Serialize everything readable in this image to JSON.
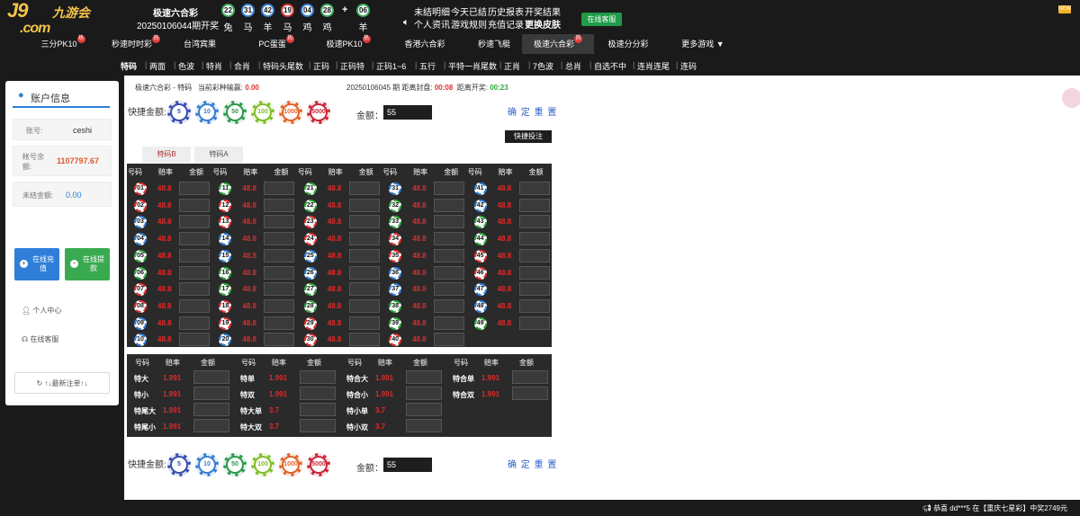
{
  "header": {
    "logo": "J9",
    "logo_sub": ".com",
    "logo_cn": "九游会",
    "draw_name": "极速六合彩",
    "draw_issue": "20250106044期开奖",
    "result_balls": [
      {
        "num": "22",
        "zodiac": "兔",
        "color": "g"
      },
      {
        "num": "31",
        "zodiac": "马",
        "color": "b"
      },
      {
        "num": "42",
        "zodiac": "羊",
        "color": "b"
      },
      {
        "num": "19",
        "zodiac": "马",
        "color": "r"
      },
      {
        "num": "04",
        "zodiac": "鸡",
        "color": "b"
      },
      {
        "num": "28",
        "zodiac": "鸡",
        "color": "g"
      },
      {
        "num": "06",
        "zodiac": "羊",
        "color": "g"
      }
    ],
    "plus": "+",
    "links_row1": [
      "未结明细",
      "今天已结",
      "历史报表",
      "开奖结果"
    ],
    "links_row2": [
      "个人资讯",
      "游戏规则",
      "充值记录",
      "更换皮肤"
    ],
    "cs_button": "在线客服",
    "new_tag": "NEW"
  },
  "game_nav": [
    {
      "label": "三分PK10",
      "hot": true
    },
    {
      "label": "秒速时时彩",
      "hot": true
    },
    {
      "label": "台湾宾果",
      "hot": false
    },
    {
      "label": "PC蛋蛋",
      "hot": true
    },
    {
      "label": "极速PK10",
      "hot": true
    },
    {
      "label": "香港六合彩",
      "hot": false
    },
    {
      "label": "秒速飞艇",
      "hot": false
    },
    {
      "label": "极速六合彩",
      "hot": true
    },
    {
      "label": "极速分分彩",
      "hot": false
    },
    {
      "label": "更多游戏 ▼",
      "hot": false
    }
  ],
  "hot_label": "热",
  "sub_nav": [
    "特码",
    "两面",
    "色波",
    "特肖",
    "合肖",
    "特码头尾数",
    "正码",
    "正码特",
    "正码1~6",
    "五行",
    "平特一肖尾数",
    "正肖",
    "7色波",
    "总肖",
    "自选不中",
    "连肖连尾",
    "连码"
  ],
  "sidebar": {
    "title": "账户信息",
    "account_label": "账号:",
    "account_value": "ceshi",
    "balance_label": "帐号余额:",
    "balance_value": "1107797.67",
    "unsettled_label": "未结金额:",
    "unsettled_value": "0.00",
    "deposit_label": "在线充值",
    "withdraw_label": "在线提款",
    "personal_center": "个人中心",
    "online_service": "在线客服",
    "refresh": "↑↓最新注单↑↓"
  },
  "content": {
    "crumb_game": "极速六合彩",
    "crumb_dash": "-",
    "crumb_play": "特码",
    "crumb_win_label": "当前彩种输赢:",
    "crumb_win_value": "0.00",
    "crumb_issue": "20250106045 期 距离封盘:",
    "crumb_close_time": "00:08",
    "crumb_draw_label": "距离开奖:",
    "crumb_draw_time": "00:23",
    "quick_amount_label": "快捷金额:",
    "chips": [
      {
        "value": "5",
        "color": "#3a4fb0"
      },
      {
        "value": "10",
        "color": "#3a7fd0"
      },
      {
        "value": "50",
        "color": "#2e9a50"
      },
      {
        "value": "100",
        "color": "#7fbf2a"
      },
      {
        "value": "1000",
        "color": "#e2642a"
      },
      {
        "value": "5000",
        "color": "#c8283a"
      }
    ],
    "amount_label": "金额：",
    "amount_value": "55",
    "confirm": "确 定",
    "reset": "重 置",
    "quick_bet": "快捷投注",
    "tabs": [
      "特码B",
      "特码A"
    ],
    "col_headers": [
      "号码",
      "赔率",
      "金额"
    ],
    "odds": "48.8",
    "numbers": [
      [
        "01",
        "r"
      ],
      [
        "02",
        "r"
      ],
      [
        "03",
        "b"
      ],
      [
        "04",
        "b"
      ],
      [
        "05",
        "g"
      ],
      [
        "06",
        "g"
      ],
      [
        "07",
        "r"
      ],
      [
        "08",
        "r"
      ],
      [
        "09",
        "b"
      ],
      [
        "10",
        "b"
      ],
      [
        "11",
        "g"
      ],
      [
        "12",
        "r"
      ],
      [
        "13",
        "r"
      ],
      [
        "14",
        "b"
      ],
      [
        "15",
        "b"
      ],
      [
        "16",
        "g"
      ],
      [
        "17",
        "g"
      ],
      [
        "18",
        "r"
      ],
      [
        "19",
        "r"
      ],
      [
        "20",
        "b"
      ],
      [
        "21",
        "g"
      ],
      [
        "22",
        "g"
      ],
      [
        "23",
        "r"
      ],
      [
        "24",
        "r"
      ],
      [
        "25",
        "b"
      ],
      [
        "26",
        "b"
      ],
      [
        "27",
        "g"
      ],
      [
        "28",
        "g"
      ],
      [
        "29",
        "r"
      ],
      [
        "30",
        "r"
      ],
      [
        "31",
        "b"
      ],
      [
        "32",
        "g"
      ],
      [
        "33",
        "g"
      ],
      [
        "34",
        "r"
      ],
      [
        "35",
        "r"
      ],
      [
        "36",
        "b"
      ],
      [
        "37",
        "b"
      ],
      [
        "38",
        "g"
      ],
      [
        "39",
        "g"
      ],
      [
        "40",
        "r"
      ],
      [
        "41",
        "b"
      ],
      [
        "42",
        "b"
      ],
      [
        "43",
        "g"
      ],
      [
        "44",
        "g"
      ],
      [
        "45",
        "r"
      ],
      [
        "46",
        "r"
      ],
      [
        "47",
        "b"
      ],
      [
        "48",
        "b"
      ],
      [
        "49",
        "g"
      ]
    ],
    "twoside_headers": [
      "号码",
      "赔率",
      "金额"
    ],
    "twoside": [
      [
        [
          "特大",
          "1.991"
        ],
        [
          "特单",
          "1.991"
        ],
        [
          "特合大",
          "1.991"
        ],
        [
          "特合单",
          "1.991"
        ]
      ],
      [
        [
          "特小",
          "1.991"
        ],
        [
          "特双",
          "1.991"
        ],
        [
          "特合小",
          "1.991"
        ],
        [
          "特合双",
          "1.991"
        ]
      ],
      [
        [
          "特尾大",
          "1.991"
        ],
        [
          "特大单",
          "3.7"
        ],
        [
          "特小单",
          "3.7"
        ],
        null
      ],
      [
        [
          "特尾小",
          "1.991"
        ],
        [
          "特大双",
          "3.7"
        ],
        [
          "特小双",
          "3.7"
        ],
        null
      ]
    ]
  },
  "ticker": "恭喜 dd***5 在【重庆七星彩】中奖2749元"
}
